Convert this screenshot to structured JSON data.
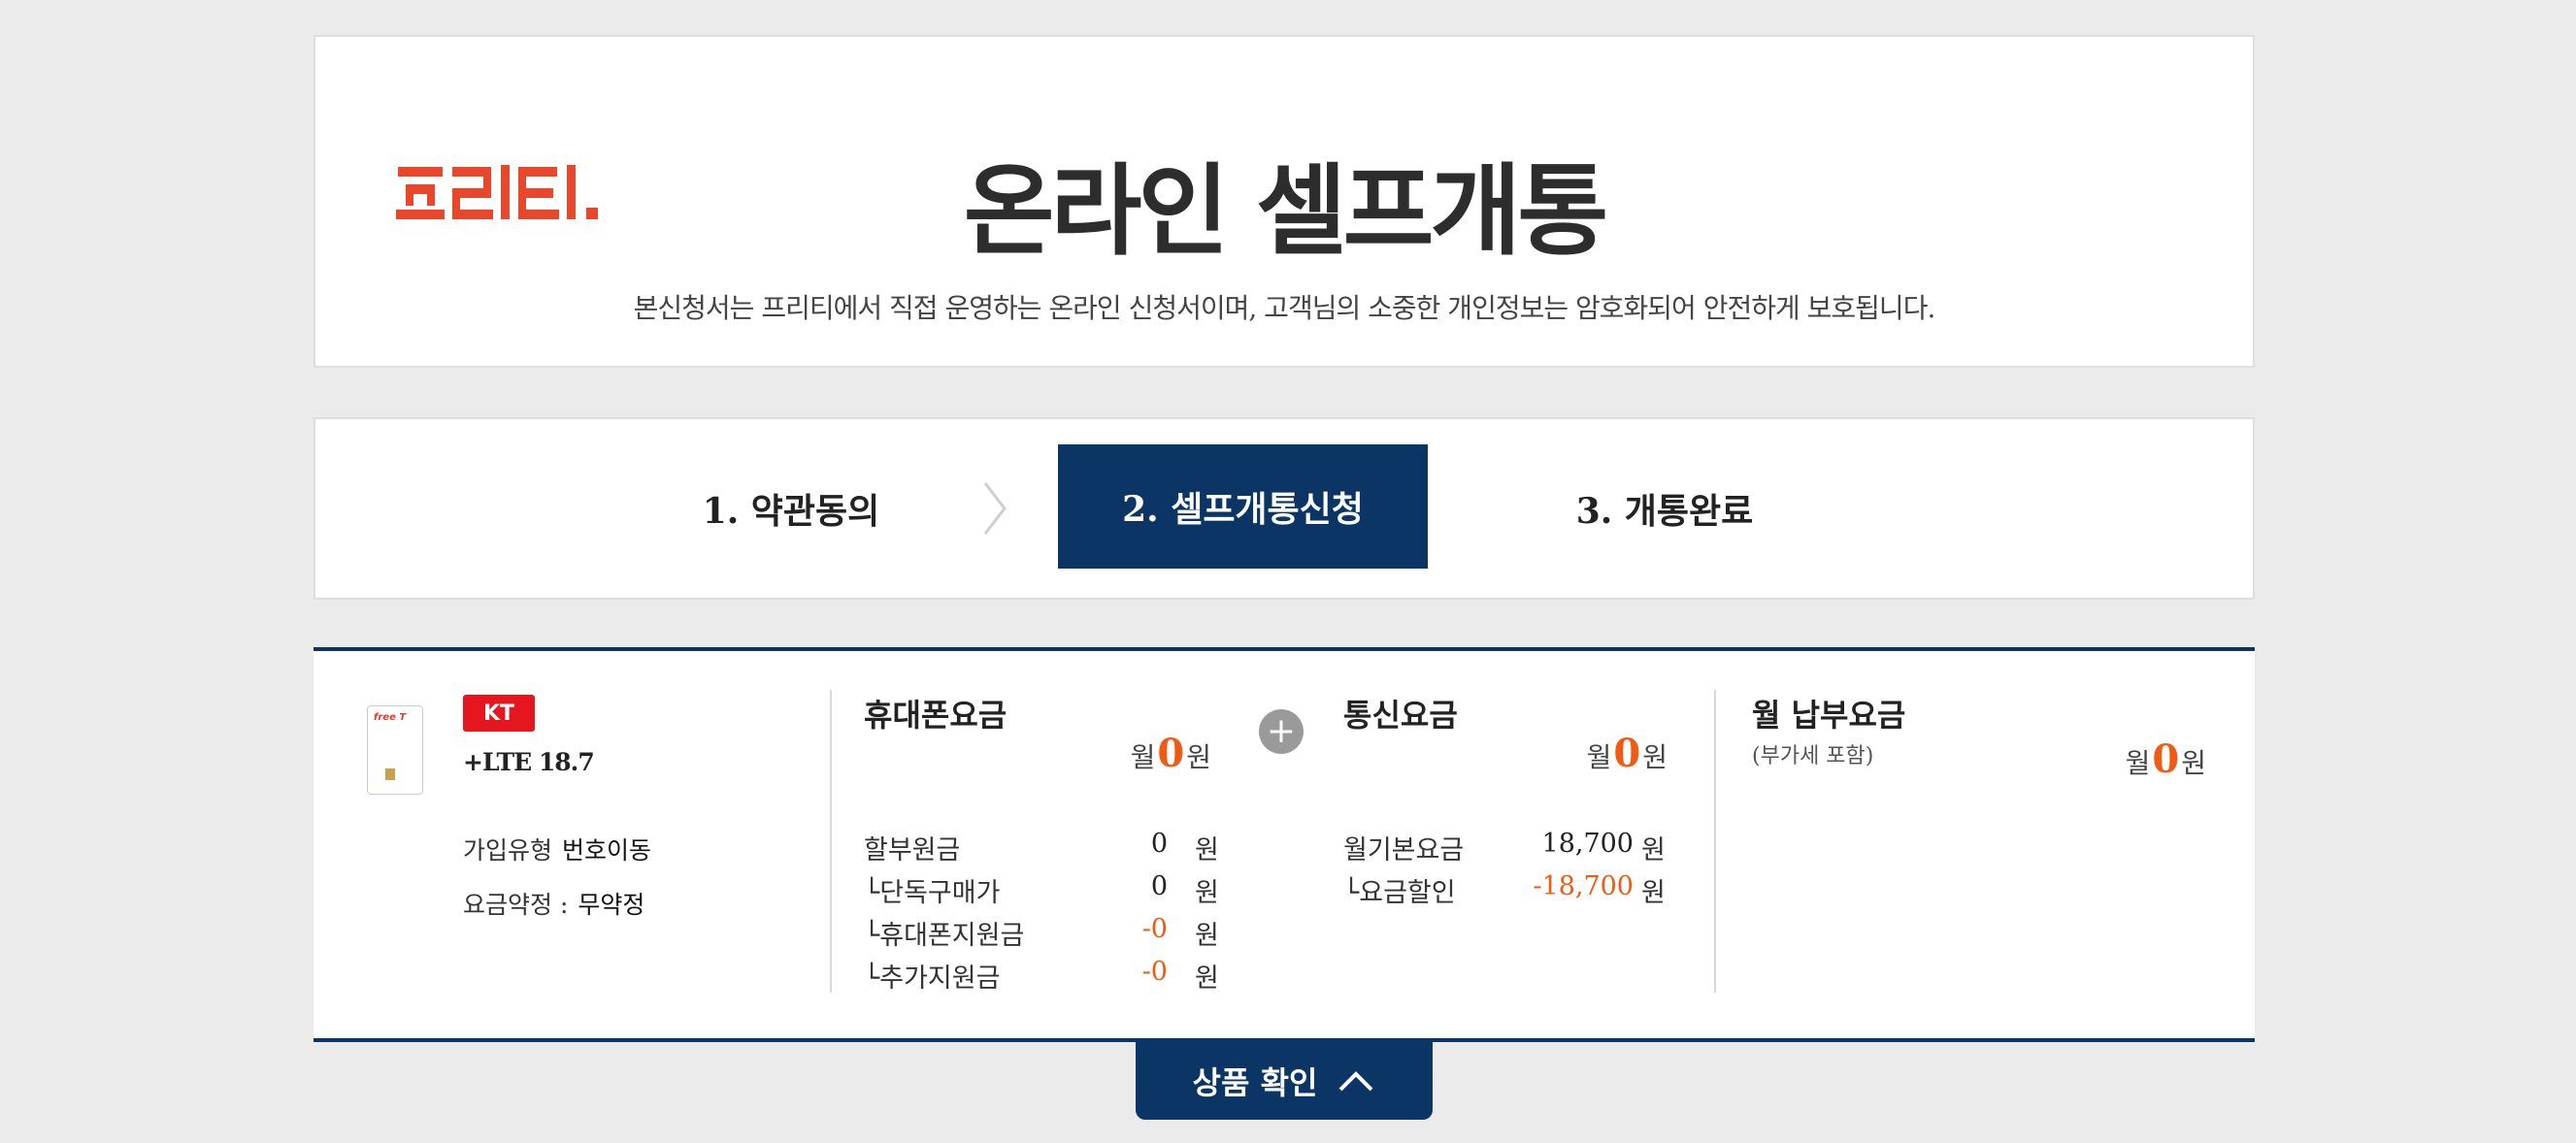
{
  "header": {
    "logo_text": "프리티.",
    "title": "온라인 셀프개통",
    "subtitle": "본신청서는 프리티에서 직접 운영하는 온라인 신청서이며, 고객님의 소중한 개인정보는 암호화되어 안전하게 보호됩니다."
  },
  "steps": [
    {
      "label": "1. 약관동의"
    },
    {
      "label": "2. 셀프개통신청",
      "active": true
    },
    {
      "label": "3. 개통완료"
    }
  ],
  "product": {
    "sim_brand": "free T",
    "carrier": "KT",
    "plan_name": "+LTE 18.7",
    "join_type_label": "가입유형",
    "join_type_value": "번호이동",
    "contract_label": "요금약정 :",
    "contract_value": "무약정"
  },
  "phone_fee": {
    "title": "휴대폰요금",
    "monthly_prefix": "월",
    "monthly_amount": "0",
    "monthly_suffix": "원",
    "rows": [
      {
        "label": "할부원금",
        "amount": "0",
        "unit": "원"
      },
      {
        "label": "└단독구매가",
        "amount": "0",
        "unit": "원"
      },
      {
        "label": "└휴대폰지원금",
        "amount": "-0",
        "unit": "원"
      },
      {
        "label": "└추가지원금",
        "amount": "-0",
        "unit": "원"
      }
    ]
  },
  "service_fee": {
    "title": "통신요금",
    "monthly_prefix": "월",
    "monthly_amount": "0",
    "monthly_suffix": "원",
    "rows": [
      {
        "label": "월기본요금",
        "amount": "18,700",
        "unit": "원"
      },
      {
        "label": "└요금할인",
        "amount": "-18,700",
        "unit": "원"
      }
    ]
  },
  "total_fee": {
    "title": "월 납부요금",
    "note": "(부가세 포함)",
    "monthly_prefix": "월",
    "monthly_amount": "0",
    "monthly_suffix": "원"
  },
  "confirm_button": {
    "label": "상품 확인"
  },
  "colors": {
    "brand_red": "#e8472b",
    "navy": "#0b3565",
    "accent_orange": "#f05a14",
    "carrier_red": "#e5161e"
  }
}
